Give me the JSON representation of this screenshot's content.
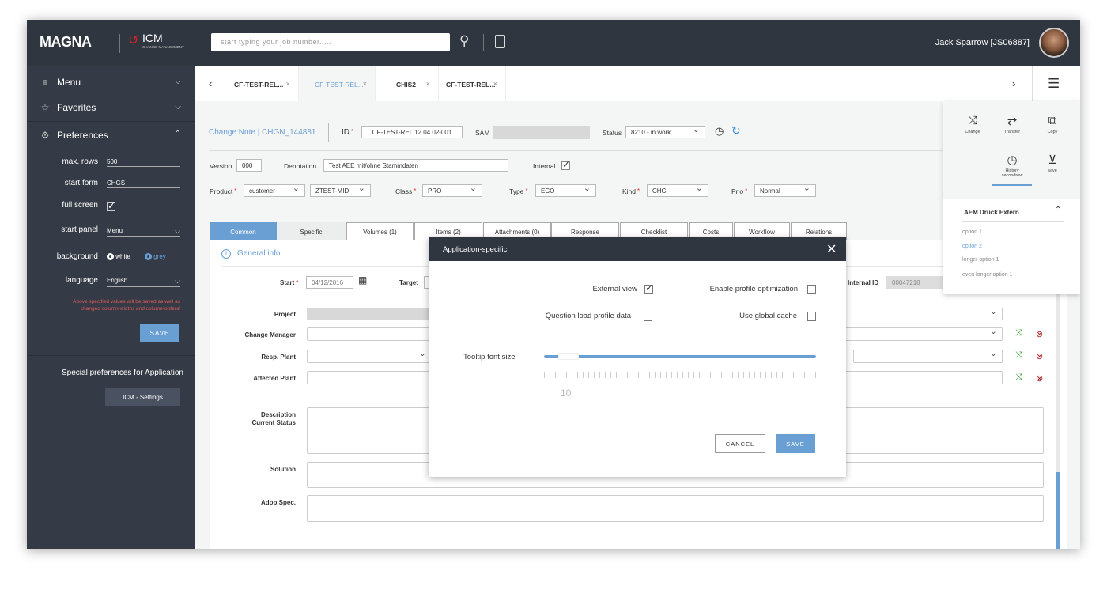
{
  "header": {
    "brand": "MAGNA",
    "app": "ICM",
    "app_sub": "CHANGE MANAGEMENT",
    "search_placeholder": "start typing your job number.....",
    "user": "Jack Sparrow [JS06887]"
  },
  "sidebar": {
    "items": [
      {
        "label": "Menu",
        "icon": "hamburger-icon",
        "expanded": false
      },
      {
        "label": "Favorites",
        "icon": "star-icon",
        "expanded": false
      },
      {
        "label": "Preferences",
        "icon": "gear-icon",
        "expanded": true
      }
    ],
    "prefs": {
      "max_rows_label": "max. rows",
      "max_rows": "500",
      "start_form_label": "start form",
      "start_form": "CHGS",
      "full_screen_label": "full screen",
      "full_screen": true,
      "start_panel_label": "start panel",
      "start_panel": "Menu",
      "background_label": "background",
      "background_options": [
        "white",
        "grey"
      ],
      "background_selected": "grey",
      "language_label": "language",
      "language": "English",
      "warning": "Above specified values will be saved as well as changed column-widths and column-orders!",
      "save": "SAVE"
    },
    "special_label": "Special preferences for  Application",
    "icm_settings": "ICM - Settings"
  },
  "tabs": [
    {
      "label": "CF-TEST-REL...",
      "active": false
    },
    {
      "label": "CF-TEST-REL...",
      "active": true
    },
    {
      "label": "CHIS2",
      "active": false
    },
    {
      "label": "CF-TEST-REL...",
      "active": false
    }
  ],
  "record": {
    "title": "Change Note | CHGN_144881",
    "id_label": "ID",
    "id": "CF-TEST-REL 12.04.02-001",
    "sam_label": "SAM",
    "status_label": "Status",
    "status": "8210 - in work",
    "version_label": "Version",
    "version": "000",
    "denotation_label": "Denotation",
    "denotation": "Test AEE mit/ohne Stammdaten",
    "internal_label": "Internal",
    "internal": true,
    "product_label": "Product",
    "product": "customer",
    "product2": "ZTEST-MID",
    "class_label": "Class",
    "class": "PRO",
    "type_label": "Type",
    "type": "ECO",
    "kind_label": "Kind",
    "kind": "CHG",
    "prio_label": "Prio",
    "prio": "Normal"
  },
  "form_tabs": [
    "Common",
    "Specific",
    "Volumes (1)",
    "Items (2)",
    "Attachments (0)",
    "Response",
    "Checklist",
    "Costs",
    "Workflow",
    "Relations"
  ],
  "general": {
    "section": "General info",
    "start_label": "Start",
    "start": "04/12/2016",
    "target_label": "Target",
    "internal_id_label": "Internal ID",
    "internal_id": "00047218",
    "project": "Project",
    "change_manager": "Change Manager",
    "resp_plant": "Resp. Plant",
    "affected_plant": "Affected Plant",
    "description": "Description\nCurrent Status",
    "solution": "Solution",
    "adop": "Adop.Spec."
  },
  "right_panel": {
    "tools": [
      {
        "label": "Change",
        "icon": "shuffle-icon"
      },
      {
        "label": "Transfer",
        "icon": "transfer-icon"
      },
      {
        "label": "Copy",
        "icon": "copy-icon"
      },
      {
        "label": "History secondrow",
        "icon": "history-icon"
      },
      {
        "label": "save",
        "icon": "download-icon"
      }
    ],
    "group": "AEM Druck Extern",
    "options": [
      "option 1",
      "option 2",
      "longer option 1",
      "even longer option 1"
    ],
    "selected_option": "option 2"
  },
  "modal": {
    "title": "Application-specific",
    "external_view": "External view",
    "external_view_checked": true,
    "enable_profile": "Enable profile optimization",
    "enable_profile_checked": false,
    "question_load": "Question load profile data",
    "question_load_checked": false,
    "global_cache": "Use global cache",
    "global_cache_checked": false,
    "tooltip_label": "Tooltip font size",
    "tooltip_value": "10",
    "cancel": "CANCEL",
    "save": "SAVE"
  },
  "colors": {
    "accent": "#6a9fd4",
    "header": "#2f3640",
    "sidebar": "#343b46",
    "warning": "#e05a5a",
    "green": "#2a9a2a",
    "red": "#b02020"
  }
}
